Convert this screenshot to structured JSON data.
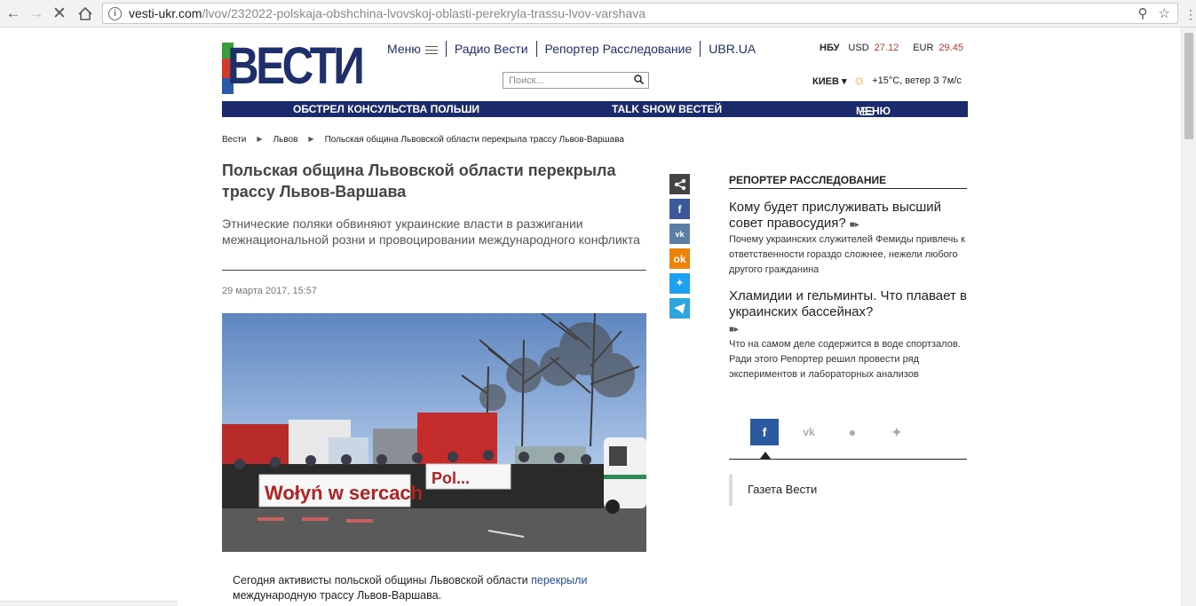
{
  "browser": {
    "url_domain": "vesti-ukr.com",
    "url_path": "/lvov/232022-polskaja-obshchina-lvovskoj-oblasti-perekryla-trassu-lvov-varshava"
  },
  "logo": {
    "text": "ВЕСТИ"
  },
  "topnav": {
    "menu": "Меню",
    "radio": "Радио Вести",
    "reporter": "Репортер Расследование",
    "ubr": "UBR.UA"
  },
  "rates": {
    "nbu": "НБУ",
    "usd_label": "USD",
    "usd_value": "27.12",
    "eur_label": "EUR",
    "eur_value": "29.45"
  },
  "search": {
    "placeholder": "Поиск..."
  },
  "weather": {
    "city": "КИЕВ",
    "text": "+15°С, ветер З 7м/с"
  },
  "bluebar": {
    "item1": "ОБСТРЕЛ КОНСУЛЬСТВА ПОЛЬШИ",
    "item2": "TALK SHOW ВЕСТЕЙ",
    "menu": "МЕНЮ"
  },
  "breadcrumb": {
    "home": "Вести",
    "section": "Львов",
    "current": "Польская община Львовской области перекрыла трассу Львов-Варшава"
  },
  "article": {
    "title": "Польская община Львовской области перекрыла трассу Львов-Варшава",
    "lead": "Этнические поляки обвиняют украинские власти в разжигании межнациональной розни и провоцировании международного конфликта",
    "date": "29 марта 2017, 15:57",
    "photo_banner_1": "Wołyń w sercach",
    "photo_banner_2": "Pol...",
    "body_1": "Сегодня активисты польской общины Львовской области ",
    "body_link": "перекрыли",
    "body_2": " международную трассу Львов-Варшава."
  },
  "share": {
    "share": "share",
    "facebook": "f",
    "vk": "вк",
    "ok": "ок",
    "twitter": "tw",
    "telegram": "tg"
  },
  "sidebar": {
    "section_title": "РЕПОРТЕР РАССЛЕДОВАНИЕ",
    "articles": [
      {
        "title": "Кому будет прислуживать высший совет правосудия?",
        "desc": "Почему украинских служителей Фемиды привлечь к ответственности гораздо сложнее, нежели любого другого гражданина"
      },
      {
        "title": "Хламидии и гельминты. Что плавает в украинских бассейнах?",
        "desc": "Что на самом деле содержится в воде спортзалов. Ради этого Репортер решил провести ряд экспериментов и лабораторных анализов"
      }
    ],
    "gazeta": "Газета Вести"
  },
  "colors": {
    "brand": "#1b2a6b",
    "accent_red": "#c0392b",
    "facebook": "#3b5998",
    "vk": "#5b7fa6",
    "ok": "#ee8208",
    "twitter": "#1da1f2",
    "telegram": "#2ca5e0"
  }
}
